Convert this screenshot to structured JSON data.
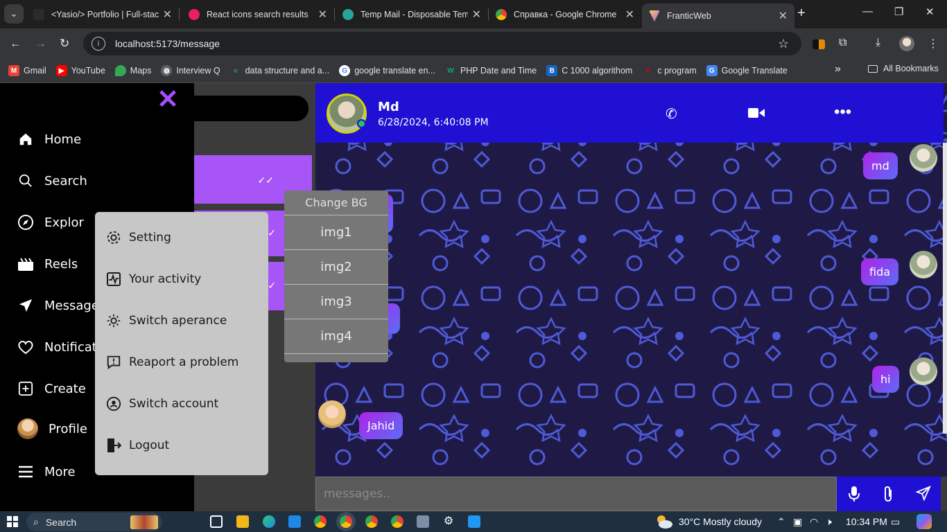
{
  "browser": {
    "tabs": [
      {
        "title": "<Yasio/> Portfolio | Full-stac",
        "color": "#2b2b2b"
      },
      {
        "title": "React icons search results",
        "color": "#e91e63"
      },
      {
        "title": "Temp Mail - Disposable Tem",
        "color": "#26a69a"
      },
      {
        "title": "Справка - Google Chrome",
        "color": "#4285f4"
      },
      {
        "title": "FranticWeb",
        "color": "#a855f7"
      }
    ],
    "active_tab": 4,
    "url": "localhost:5173/message",
    "bookmarks": [
      {
        "label": "Gmail",
        "icon": "gmail-icon",
        "color": "#ea4335"
      },
      {
        "label": "YouTube",
        "icon": "youtube-icon",
        "color": "#ff0000"
      },
      {
        "label": "Maps",
        "icon": "maps-icon",
        "color": "#34a853"
      },
      {
        "label": "Interview Q",
        "icon": "globe-icon",
        "color": "#9aa0a6"
      },
      {
        "label": "data structure and a...",
        "icon": "gfg-icon",
        "color": "#2f8d46"
      },
      {
        "label": "google translate en...",
        "icon": "google-icon",
        "color": "#4285f4"
      },
      {
        "label": "PHP Date and Time",
        "icon": "w3-icon",
        "color": "#04aa6d"
      },
      {
        "label": "C 1000  algorithom",
        "icon": "bookmark-icon",
        "color": "#1565c0"
      },
      {
        "label": "c program",
        "icon": "bookmark-icon",
        "color": "#d50000"
      },
      {
        "label": "Google Translate",
        "icon": "translate-icon",
        "color": "#4285f4"
      }
    ],
    "all_bookmarks": "All Bookmarks"
  },
  "sidebar": {
    "items": [
      {
        "label": "Home",
        "icon": "home-icon"
      },
      {
        "label": "Search",
        "icon": "search-icon"
      },
      {
        "label": "Explor",
        "icon": "compass-icon"
      },
      {
        "label": "Reels",
        "icon": "reels-icon"
      },
      {
        "label": "Message",
        "icon": "send-icon"
      },
      {
        "label": "Notificati",
        "icon": "heart-icon"
      },
      {
        "label": "Create",
        "icon": "plus-square-icon"
      },
      {
        "label": "Profile",
        "icon": "avatar"
      },
      {
        "label": "More",
        "icon": "menu-icon"
      }
    ]
  },
  "settings_menu": {
    "items": [
      {
        "label": "Setting",
        "icon": "gear-icon"
      },
      {
        "label": "Your activity",
        "icon": "activity-icon"
      },
      {
        "label": "Switch aperance",
        "icon": "sun-icon"
      },
      {
        "label": "Reaport a problem",
        "icon": "report-icon"
      },
      {
        "label": "Switch account",
        "icon": "account-switch-icon"
      },
      {
        "label": "Logout",
        "icon": "logout-icon"
      }
    ]
  },
  "bg_menu": {
    "title": "Change BG",
    "options": [
      "img1",
      "img2",
      "img3",
      "img4"
    ]
  },
  "chat": {
    "contact_name": "Md",
    "last_seen": "6/28/2024, 6:40:08 PM",
    "messages": [
      {
        "text": "md",
        "side": "right"
      },
      {
        "text": "fida",
        "side": "right"
      },
      {
        "text": "hi",
        "side": "right"
      },
      {
        "text": "Jahid",
        "side": "left"
      }
    ],
    "input_placeholder": "messages.."
  },
  "taskbar": {
    "search_placeholder": "Search",
    "weather": "30°C  Mostly cloudy",
    "time": "10:34 PM"
  }
}
